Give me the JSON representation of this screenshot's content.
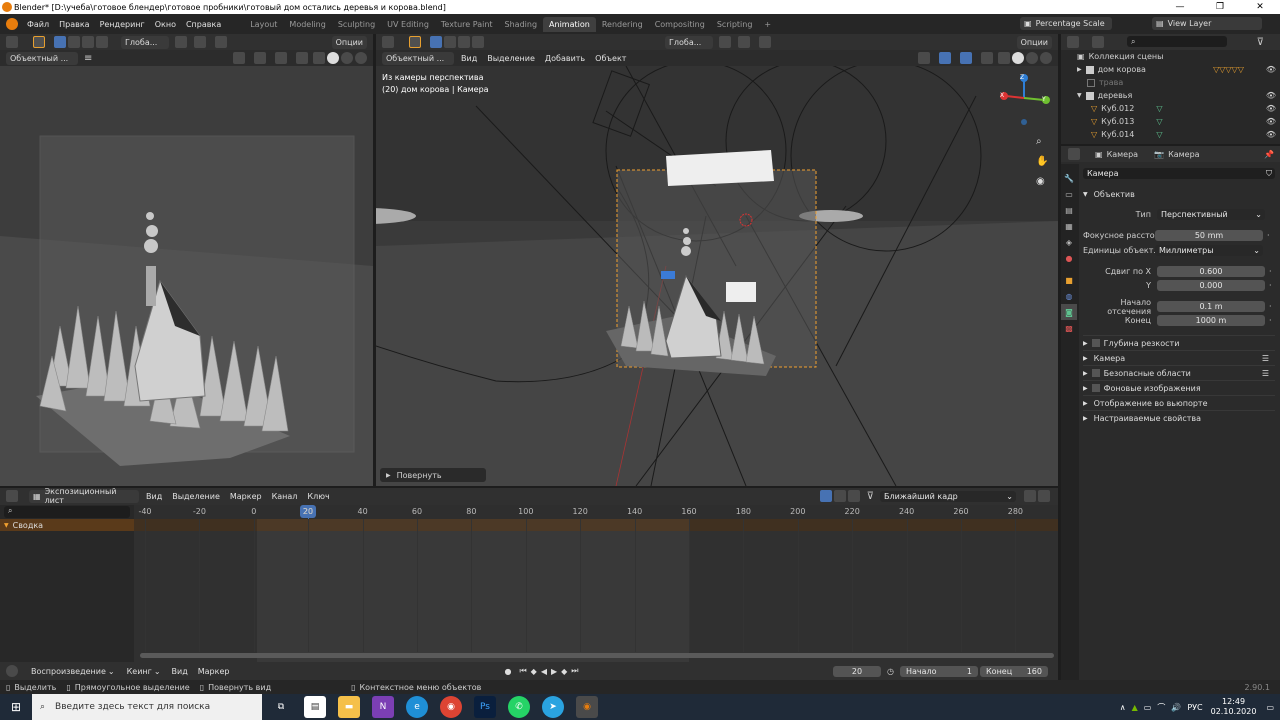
{
  "window": {
    "title": "Blender* [D:\\учеба\\готовое блендер\\готовое пробники\\готовый дом остались деревья и корова.blend]",
    "minimize": "—",
    "maximize": "❐",
    "close": "✕"
  },
  "menu": [
    "Файл",
    "Правка",
    "Рендеринг",
    "Окно",
    "Справка"
  ],
  "workspaces": [
    "Layout",
    "Modeling",
    "Sculpting",
    "UV Editing",
    "Texture Paint",
    "Shading",
    "Animation",
    "Rendering",
    "Compositing",
    "Scripting"
  ],
  "active_workspace": "Animation",
  "topright": {
    "scale": "Percentage Scale",
    "view_layer": "View Layer"
  },
  "left_view": {
    "transform": "Глоба...",
    "options": "Опции",
    "mode": "Объектный ..."
  },
  "right_view": {
    "transform": "Глоба...",
    "options": "Опции",
    "mode": "Объектный ...",
    "menus": [
      "Вид",
      "Выделение",
      "Добавить",
      "Объект"
    ],
    "overlay_line1": "Из камеры перспектива",
    "overlay_line2": "(20) дом корова  | Камера",
    "last_op": "Повернуть",
    "gizmo": {
      "x": "X",
      "y": "Y",
      "z": "Z"
    }
  },
  "outliner": {
    "title": "Коллекция сцены",
    "items": [
      {
        "label": "дом корова"
      },
      {
        "label": "трава"
      },
      {
        "label": "деревья"
      },
      {
        "label": "Куб.012"
      },
      {
        "label": "Куб.013"
      },
      {
        "label": "Куб.014"
      }
    ]
  },
  "props": {
    "breadcrumb1": "Камера",
    "breadcrumb2": "Камера",
    "datablock": "Камера",
    "section": "Объектив",
    "type_label": "Тип",
    "type_value": "Перспективный",
    "focal_label": "Фокусное рассто...",
    "focal_value": "50 mm",
    "units_label": "Единицы объект...",
    "units_value": "Миллиметры",
    "shift_x_label": "Сдвиг по X",
    "shift_x_value": "0.600",
    "shift_y_label": "Y",
    "shift_y_value": "0.000",
    "clip_start_label": "Начало отсечения",
    "clip_start_value": "0.1 m",
    "clip_end_label": "Конец",
    "clip_end_value": "1000 m",
    "panels": [
      "Глубина резкости",
      "Камера",
      "Безопасные области",
      "Фоновые изображения",
      "Отображение во вьюпорте",
      "Настраиваемые свойства"
    ]
  },
  "timeline": {
    "editor": "Экспозиционный лист",
    "menus": [
      "Вид",
      "Выделение",
      "Маркер",
      "Канал",
      "Ключ"
    ],
    "snap": "Ближайший кадр",
    "summary": "Сводка",
    "ticks": [
      "-40",
      "-20",
      "0",
      "20",
      "40",
      "60",
      "80",
      "100",
      "120",
      "140",
      "160",
      "180",
      "200",
      "220",
      "240",
      "260",
      "280"
    ],
    "current_frame": "20"
  },
  "playback": {
    "playback": "Воспроизведение",
    "keying": "Кеинг",
    "view": "Вид",
    "marker": "Маркер",
    "frame": "20",
    "start_label": "Начало",
    "start": "1",
    "end_label": "Конец",
    "end": "160"
  },
  "status": {
    "select": "Выделить",
    "box": "Прямоугольное выделение",
    "rotate": "Повернуть вид",
    "context": "Контекстное меню объектов",
    "version": "2.90.1"
  },
  "taskbar": {
    "search": "Введите здесь текст для поиска",
    "lang": "РУС",
    "time": "12:49",
    "date": "02.10.2020"
  },
  "colors": {
    "accent": "#4772b3",
    "camera_frame": "#f0a030",
    "header": "#303030"
  }
}
